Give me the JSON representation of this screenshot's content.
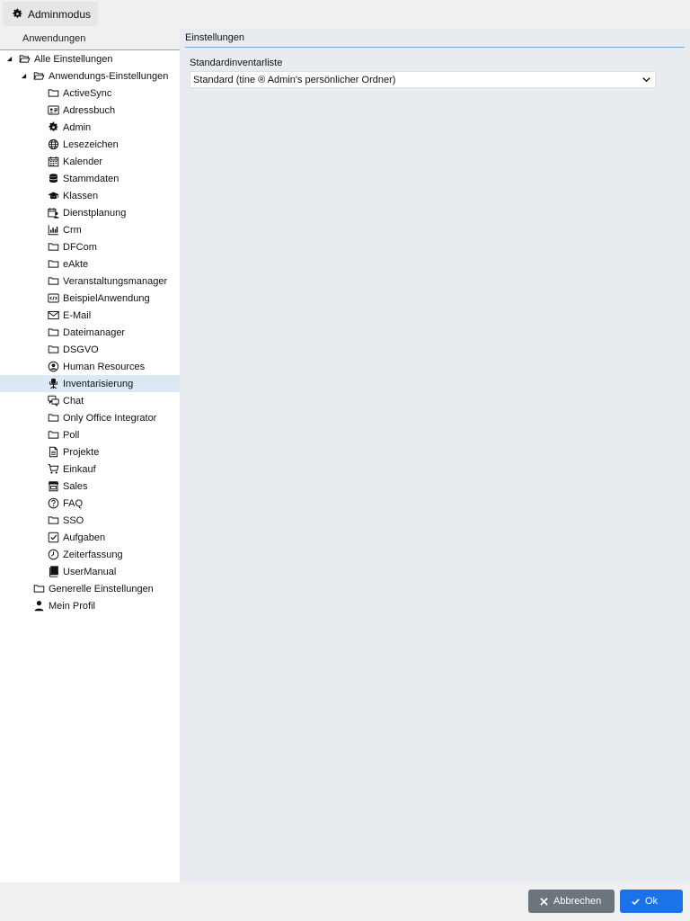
{
  "topbar": {
    "admin_label": "Adminmodus"
  },
  "left": {
    "header": "Anwendungen",
    "tree": [
      {
        "label": "Alle Einstellungen",
        "level": 0,
        "toggle": "open",
        "icon": "folder-open-icon"
      },
      {
        "label": "Anwendungs-Einstellungen",
        "level": 1,
        "toggle": "open",
        "icon": "folder-open-icon"
      },
      {
        "label": "ActiveSync",
        "level": 2,
        "icon": "folder-icon"
      },
      {
        "label": "Adressbuch",
        "level": 2,
        "icon": "address-card-icon"
      },
      {
        "label": "Admin",
        "level": 2,
        "icon": "gear-icon"
      },
      {
        "label": "Lesezeichen",
        "level": 2,
        "icon": "globe-icon"
      },
      {
        "label": "Kalender",
        "level": 2,
        "icon": "calendar-icon"
      },
      {
        "label": "Stammdaten",
        "level": 2,
        "icon": "database-icon"
      },
      {
        "label": "Klassen",
        "level": 2,
        "icon": "graduation-cap-icon"
      },
      {
        "label": "Dienstplanung",
        "level": 2,
        "icon": "calendar-user-icon"
      },
      {
        "label": "Crm",
        "level": 2,
        "icon": "bar-chart-icon"
      },
      {
        "label": "DFCom",
        "level": 2,
        "icon": "folder-icon"
      },
      {
        "label": "eAkte",
        "level": 2,
        "icon": "folder-icon"
      },
      {
        "label": "Veranstaltungsmanager",
        "level": 2,
        "icon": "folder-icon"
      },
      {
        "label": "BeispielAnwendung",
        "level": 2,
        "icon": "code-window-icon"
      },
      {
        "label": "E-Mail",
        "level": 2,
        "icon": "envelope-icon"
      },
      {
        "label": "Dateimanager",
        "level": 2,
        "icon": "folder-icon"
      },
      {
        "label": "DSGVO",
        "level": 2,
        "icon": "folder-icon"
      },
      {
        "label": "Human Resources",
        "level": 2,
        "icon": "user-circle-icon"
      },
      {
        "label": "Inventarisierung",
        "level": 2,
        "icon": "office-chair-icon",
        "selected": true
      },
      {
        "label": "Chat",
        "level": 2,
        "icon": "chat-icon"
      },
      {
        "label": "Only Office Integrator",
        "level": 2,
        "icon": "folder-icon"
      },
      {
        "label": "Poll",
        "level": 2,
        "icon": "folder-icon"
      },
      {
        "label": "Projekte",
        "level": 2,
        "icon": "document-icon"
      },
      {
        "label": "Einkauf",
        "level": 2,
        "icon": "shopping-cart-icon"
      },
      {
        "label": "Sales",
        "level": 2,
        "icon": "store-icon"
      },
      {
        "label": "FAQ",
        "level": 2,
        "icon": "question-circle-icon"
      },
      {
        "label": "SSO",
        "level": 2,
        "icon": "folder-icon"
      },
      {
        "label": "Aufgaben",
        "level": 2,
        "icon": "check-square-icon"
      },
      {
        "label": "Zeiterfassung",
        "level": 2,
        "icon": "clock-icon"
      },
      {
        "label": "UserManual",
        "level": 2,
        "icon": "book-icon"
      },
      {
        "label": "Generelle Einstellungen",
        "level": 1,
        "icon": "folder-icon"
      },
      {
        "label": "Mein Profil",
        "level": 1,
        "icon": "user-icon"
      }
    ]
  },
  "right": {
    "header": "Einstellungen",
    "field_label": "Standardinventarliste",
    "select_value": "Standard (tine ® Admin's persönlicher Ordner)"
  },
  "buttons": {
    "cancel": "Abbrechen",
    "ok": "Ok"
  },
  "colors": {
    "selected_row": "#dbe9f4",
    "ok_button": "#1a73e8",
    "cancel_button": "#6c757d",
    "panel_bg": "#e8ecf0"
  }
}
